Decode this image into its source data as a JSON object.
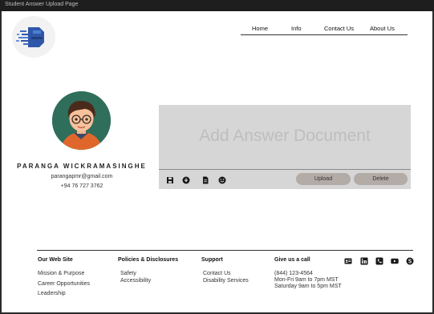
{
  "window": {
    "title": "Student Answer Upload Page"
  },
  "nav": {
    "home": "Home",
    "info": "Info",
    "contact": "Contact Us",
    "about": "About Us"
  },
  "profile": {
    "name": "PARANGA WICKRAMASINGHE",
    "email": "parangapmr@gmail.com",
    "phone": "+94 76 727 3762"
  },
  "upload": {
    "title": "Add Answer Document",
    "upload_label": "Upload",
    "delete_label": "Delete",
    "tools": [
      "save-icon",
      "download-icon",
      "document-icon",
      "emoji-icon"
    ]
  },
  "footer": {
    "col1": {
      "heading": "Our Web Site",
      "links": [
        "Mission & Purpose",
        "Career Opportunities",
        "Leadership"
      ]
    },
    "col2": {
      "heading": "Policies & Disclosures",
      "links": [
        "Safety",
        "Accessibility"
      ]
    },
    "col3": {
      "heading": "Support",
      "links": [
        "Contact Us",
        "Disability Services"
      ]
    },
    "col4": {
      "heading": "Give us a call",
      "lines": [
        "(844) 123-4564",
        "Mon-Fri 9am to 7pm MST",
        "Saturday 9am to 5pm MST"
      ]
    },
    "social_icons": [
      "contact-card-icon",
      "linkedin-icon",
      "phone-icon",
      "youtube-icon",
      "skype-icon"
    ]
  },
  "colors": {
    "panel": "#d6d6d6",
    "button": "#b3aba6",
    "frame": "#1e1e1e"
  }
}
